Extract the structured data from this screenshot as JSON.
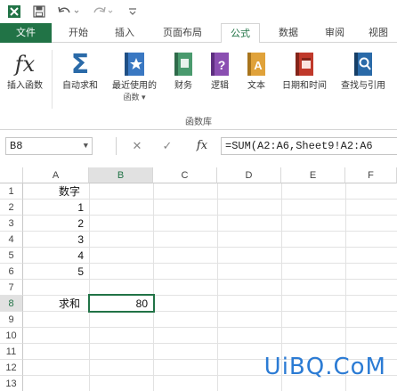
{
  "qat": {
    "icons": [
      "excel-logo-icon",
      "save-icon",
      "undo-icon",
      "redo-icon",
      "customize-qat-icon"
    ]
  },
  "tabs": [
    {
      "label": "文件"
    },
    {
      "label": "开始"
    },
    {
      "label": "插入"
    },
    {
      "label": "页面布局"
    },
    {
      "label": "公式"
    },
    {
      "label": "数据"
    },
    {
      "label": "审阅"
    },
    {
      "label": "视图"
    }
  ],
  "ribbon": {
    "buttons": [
      {
        "label": "插入函数",
        "sub": "",
        "icon": "fx-icon"
      },
      {
        "label": "自动求和",
        "sub": "",
        "icon": "sigma-icon"
      },
      {
        "label": "最近使用的",
        "sub": "函数 ▾",
        "icon": "star-book-icon"
      },
      {
        "label": "财务",
        "sub": "",
        "icon": "finance-book-icon"
      },
      {
        "label": "逻辑",
        "sub": "",
        "icon": "logic-book-icon"
      },
      {
        "label": "文本",
        "sub": "",
        "icon": "text-book-icon"
      },
      {
        "label": "日期和时间",
        "sub": "",
        "icon": "calendar-book-icon"
      },
      {
        "label": "查找与引用",
        "sub": "",
        "icon": "lookup-book-icon"
      }
    ],
    "group_label": "函数库",
    "colors": {
      "sigma": "#2a6aa8",
      "star": "#3a78c2",
      "finance": "#4a9a6e",
      "logic": "#8a4fb1",
      "text": "#e0a23a",
      "date": "#c0392b",
      "lookup": "#2a6aa8"
    }
  },
  "formula_bar": {
    "name_box": "B8",
    "cancel": "✕",
    "enter": "✓",
    "fx": "fx",
    "formula": "=SUM(A2:A6,Sheet9!A2:A6"
  },
  "grid": {
    "columns": [
      "A",
      "B",
      "C",
      "D",
      "E",
      "F"
    ],
    "rows": [
      "1",
      "2",
      "3",
      "4",
      "5",
      "6",
      "7",
      "8",
      "9",
      "10",
      "11",
      "12",
      "13"
    ],
    "selected": {
      "col": "B",
      "row": "8"
    },
    "cells": {
      "a1": "数字",
      "a2": "1",
      "a3": "2",
      "a4": "3",
      "a5": "4",
      "a6": "5",
      "a8": "求和",
      "b8": "80"
    }
  },
  "watermark": "UiBQ.CoM",
  "accent": "#217346"
}
